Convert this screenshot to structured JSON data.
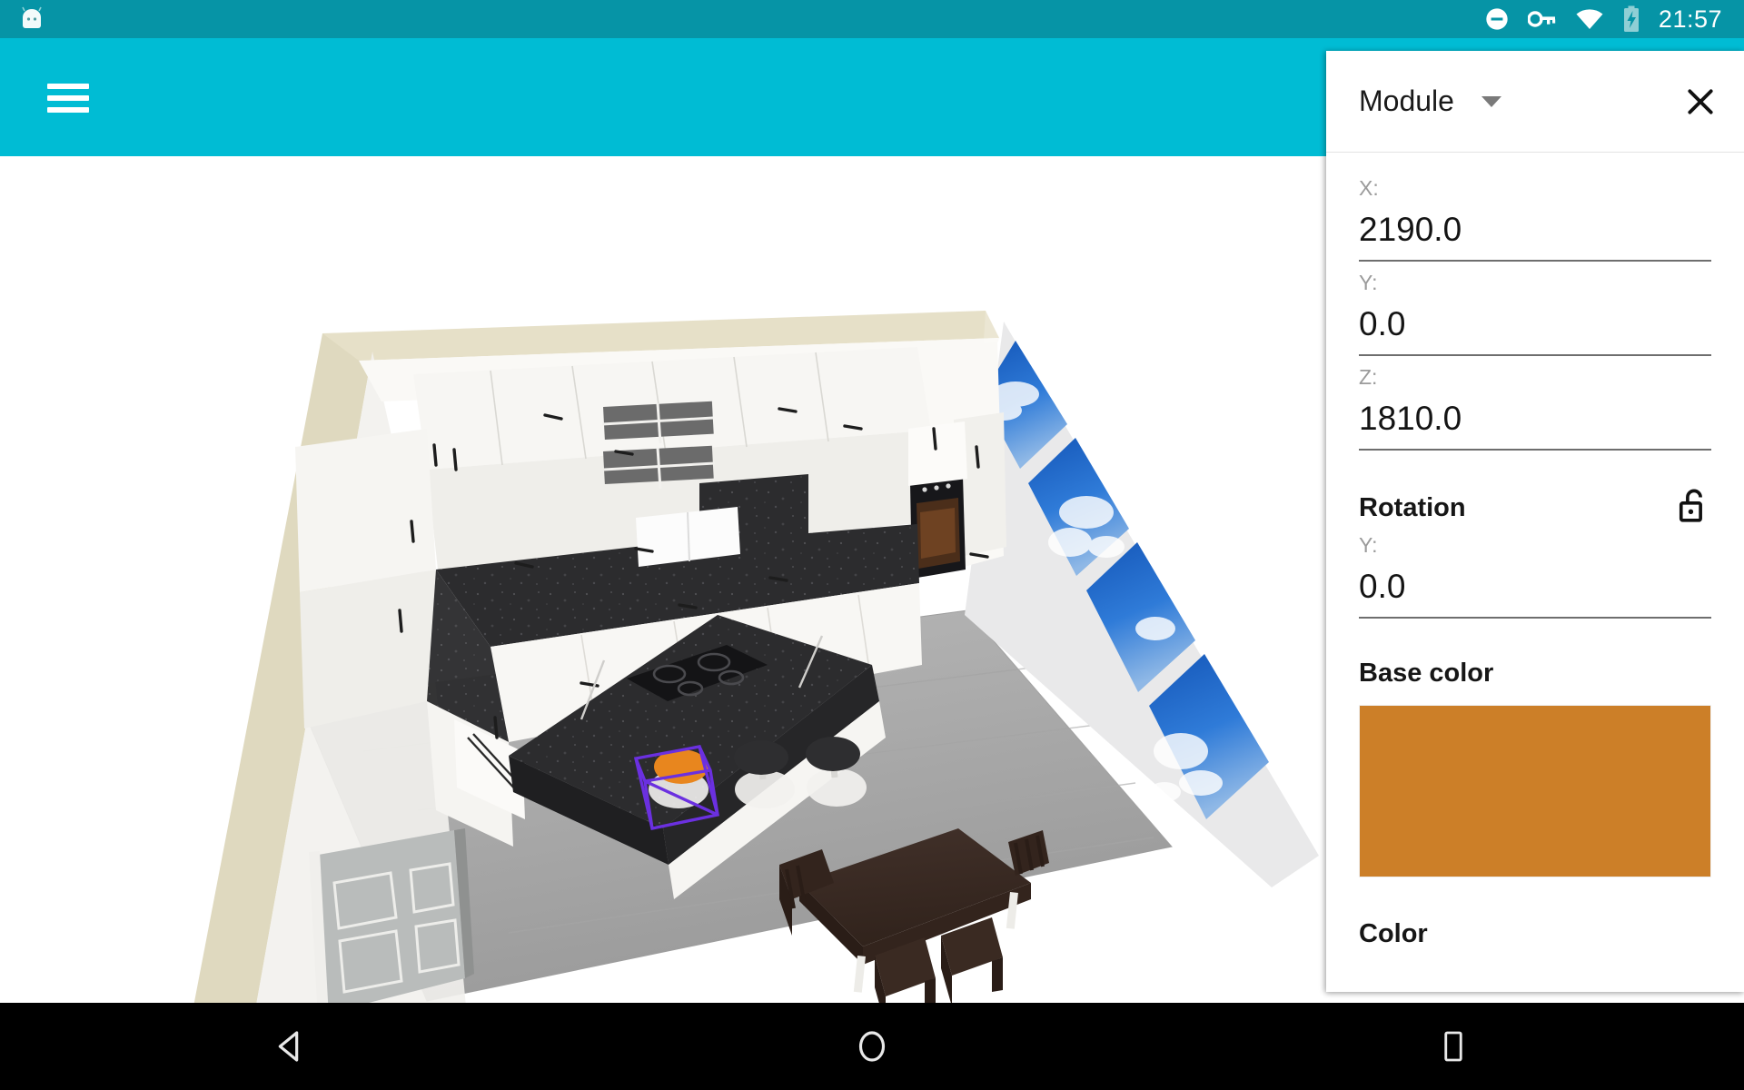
{
  "status_bar": {
    "clock": "21:57",
    "bg_color": "#0694A6",
    "icons": [
      "android-mascot-icon",
      "do-not-disturb-icon",
      "vpn-key-icon",
      "wifi-icon",
      "battery-charging-icon"
    ]
  },
  "app_bar": {
    "bg_color": "#00BCD4",
    "menu_icon": "hamburger-menu-icon"
  },
  "panel": {
    "title": "Module",
    "dropdown_icon": "chevron-down-icon",
    "close_icon": "close-icon",
    "position_fields": [
      {
        "label": "X:",
        "value": "2190.0"
      },
      {
        "label": "Y:",
        "value": "0.0"
      },
      {
        "label": "Z:",
        "value": "1810.0"
      }
    ],
    "rotation": {
      "title": "Rotation",
      "lock_icon": "lock-open-icon",
      "fields": [
        {
          "label": "Y:",
          "value": "0.0"
        }
      ]
    },
    "base_color": {
      "title": "Base color",
      "swatch_hex": "#CC7F28"
    },
    "color": {
      "title": "Color"
    }
  },
  "viewport": {
    "scene": "kitchen-3d-room",
    "selection_outline_color": "#6B30E0",
    "selected_object": "bar-stool",
    "selected_object_color": "#E8861E",
    "floor_color": "#A8A8A8",
    "wall_color": "#DED8BE",
    "counter_color": "#2E2E30",
    "cabinet_color": "#F3F2EE",
    "window_sky_color": "#1F62C4",
    "dining_set_color": "#3A2A22"
  },
  "nav_bar": {
    "bg_color": "#000000",
    "buttons": [
      {
        "name": "back-button",
        "icon": "triangle-back-icon"
      },
      {
        "name": "home-button",
        "icon": "circle-home-icon"
      },
      {
        "name": "recents-button",
        "icon": "square-recents-icon"
      }
    ]
  }
}
